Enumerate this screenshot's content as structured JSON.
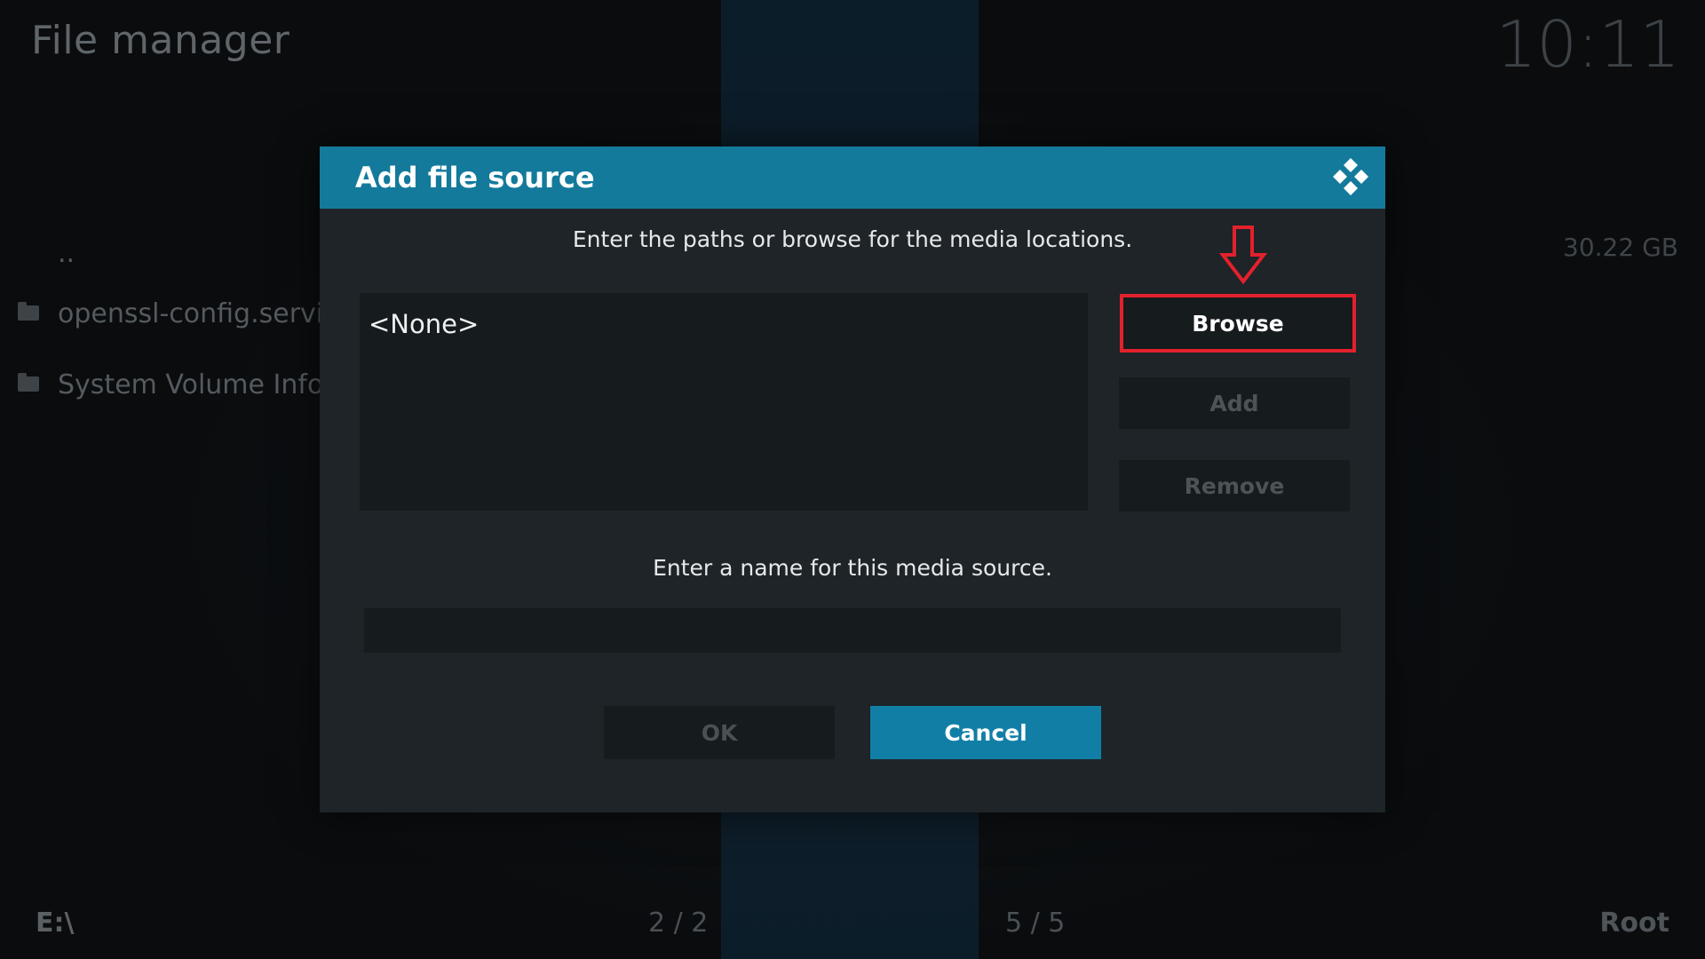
{
  "app": {
    "title": "File manager",
    "clock": "10:11"
  },
  "file_list": {
    "items": [
      {
        "label": "..",
        "icon": "none"
      },
      {
        "label": "openssl-config.service.",
        "icon": "folder-icon"
      },
      {
        "label": "System Volume Inform",
        "icon": "folder-icon"
      }
    ],
    "free_space": "30.22 GB"
  },
  "footer": {
    "path": "E:\\",
    "count_left": "2 / 2",
    "count_right": "5 / 5",
    "location": "Root"
  },
  "dialog": {
    "title": "Add file source",
    "paths_hint": "Enter the paths or browse for the media locations.",
    "paths": [
      "<None>"
    ],
    "browse_label": "Browse",
    "add_label": "Add",
    "remove_label": "Remove",
    "name_hint": "Enter a name for this media source.",
    "name_value": "",
    "ok_label": "OK",
    "cancel_label": "Cancel"
  },
  "colors": {
    "header": "#147a9b",
    "cancel": "#117fa5",
    "highlight": "#e3212d",
    "dialog_bg": "#1e2427"
  }
}
